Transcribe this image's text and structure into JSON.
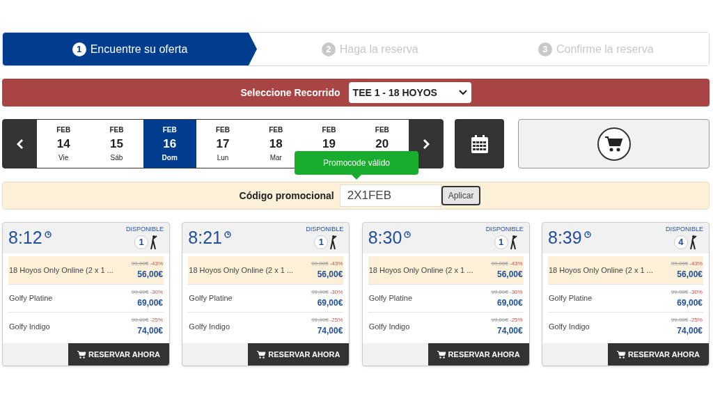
{
  "steps": [
    {
      "number": "1",
      "label": "Encuentre su oferta",
      "selected": true
    },
    {
      "number": "2",
      "label": "Haga la reserva",
      "selected": false
    },
    {
      "number": "3",
      "label": "Confirme la reserva",
      "selected": false
    }
  ],
  "course": {
    "label": "Seleccione Recorrido",
    "value": "TEE 1 - 18 HOYOS"
  },
  "days": [
    {
      "month": "FEB",
      "day": "14",
      "weekday": "Vie",
      "selected": false
    },
    {
      "month": "FEB",
      "day": "15",
      "weekday": "Sáb",
      "selected": false
    },
    {
      "month": "FEB",
      "day": "16",
      "weekday": "Dom",
      "selected": true
    },
    {
      "month": "FEB",
      "day": "17",
      "weekday": "Lun",
      "selected": false
    },
    {
      "month": "FEB",
      "day": "18",
      "weekday": "Mar",
      "selected": false
    },
    {
      "month": "FEB",
      "day": "19",
      "selected": false
    },
    {
      "month": "FEB",
      "day": "20",
      "selected": false
    }
  ],
  "promo": {
    "label": "Código promocional",
    "value": "2X1FEB",
    "button": "Aplicar",
    "tooltip": "Promocode válido"
  },
  "slots": [
    {
      "time": "8:12",
      "availability_label": "DISPONIBLE",
      "players": "1",
      "button": "RESERVAR AHORA",
      "offers": [
        {
          "name": "18 Hoyos Only Online (2 x 1 ...",
          "old_price": "99,00€",
          "discount": "-43%",
          "price": "56,00€",
          "highlighted": true
        },
        {
          "name": "Golfy Platine",
          "old_price": "99,00€",
          "discount": "-30%",
          "price": "69,00€",
          "highlighted": false
        },
        {
          "name": "Golfy Indigo",
          "old_price": "99,00€",
          "discount": "-25%",
          "price": "74,00€",
          "highlighted": false
        }
      ]
    },
    {
      "time": "8:21",
      "availability_label": "DISPONIBLE",
      "players": "1",
      "button": "RESERVAR AHORA",
      "offers": [
        {
          "name": "18 Hoyos Only Online (2 x 1 ...",
          "old_price": "99,00€",
          "discount": "-43%",
          "price": "56,00€",
          "highlighted": true
        },
        {
          "name": "Golfy Platine",
          "old_price": "99,00€",
          "discount": "-30%",
          "price": "69,00€",
          "highlighted": false
        },
        {
          "name": "Golfy Indigo",
          "old_price": "99,00€",
          "discount": "-25%",
          "price": "74,00€",
          "highlighted": false
        }
      ]
    },
    {
      "time": "8:30",
      "availability_label": "DISPONIBLE",
      "players": "1",
      "button": "RESERVAR AHORA",
      "offers": [
        {
          "name": "18 Hoyos Only Online (2 x 1 ...",
          "old_price": "99,00€",
          "discount": "-43%",
          "price": "56,00€",
          "highlighted": true
        },
        {
          "name": "Golfy Platine",
          "old_price": "99,00€",
          "discount": "-30%",
          "price": "69,00€",
          "highlighted": false
        },
        {
          "name": "Golfy Indigo",
          "old_price": "99,00€",
          "discount": "-25%",
          "price": "74,00€",
          "highlighted": false
        }
      ]
    },
    {
      "time": "8:39",
      "availability_label": "DISPONIBLE",
      "players": "4",
      "button": "RESERVAR AHORA",
      "offers": [
        {
          "name": "18 Hoyos Only Online (2 x 1 ...",
          "old_price": "99,00€",
          "discount": "-43%",
          "price": "56,00€",
          "highlighted": true
        },
        {
          "name": "Golfy Platine",
          "old_price": "99,00€",
          "discount": "-30%",
          "price": "69,00€",
          "highlighted": false
        },
        {
          "name": "Golfy Indigo",
          "old_price": "99,00€",
          "discount": "-25%",
          "price": "74,00€",
          "highlighted": false
        }
      ]
    }
  ]
}
